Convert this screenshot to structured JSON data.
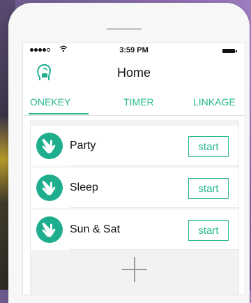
{
  "status_bar": {
    "time": "3:59 PM",
    "signal_icon": "signal-dots-icon",
    "wifi_icon": "wifi-icon",
    "battery_icon": "battery-icon"
  },
  "header": {
    "title": "Home",
    "logo_icon": "head-profile-logo-icon"
  },
  "tabs": [
    {
      "label": "ONEKEY",
      "active": true
    },
    {
      "label": "TIMER",
      "active": false
    },
    {
      "label": "LINKAGE",
      "active": false
    }
  ],
  "scenes": [
    {
      "label": "Party",
      "button": "start",
      "icon": "hand-tap-icon"
    },
    {
      "label": "Sleep",
      "button": "start",
      "icon": "hand-tap-icon"
    },
    {
      "label": "Sun & Sat",
      "button": "start",
      "icon": "hand-tap-icon"
    }
  ],
  "add_icon": "plus-icon",
  "colors": {
    "accent": "#29b890",
    "icon_bg": "#1fae8d"
  }
}
